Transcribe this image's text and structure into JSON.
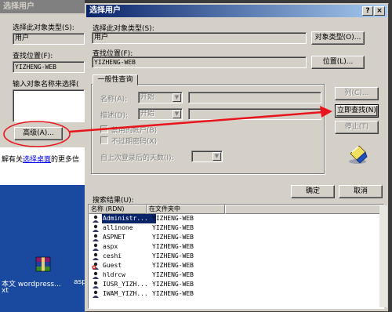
{
  "bg_dialog": {
    "title": "选择用户",
    "object_type_label": "选择此对象类型(S):",
    "object_type_value": "用户",
    "location_label": "查找位置(F):",
    "location_value": "YIZHENG-WEB",
    "enter_names_label": "输入对象名称来选择(",
    "advanced_button": "高级(A)...",
    "help_text_prefix": "解有关",
    "help_link": "选择桌面",
    "help_text_suffix": "的更多信"
  },
  "desktop": {
    "icon_label": "本文 wordpress...",
    "icon_label_2": "asp",
    "icon_label_3": "xt"
  },
  "dialog": {
    "title": "选择用户",
    "help_button": "?",
    "close_button": "×",
    "object_type_label": "选择此对象类型(S):",
    "object_type_value": "用户",
    "object_type_button": "对象类型(O)...",
    "location_label": "查找位置(F):",
    "location_value": "YIZHENG-WEB",
    "location_button": "位置(L)...",
    "tab_general": "一般性查询",
    "name_label": "名称(A):",
    "name_op": "开始",
    "desc_label": "描述(D):",
    "desc_op": "开始",
    "disabled_accounts": "禁用的帐户(B)",
    "no_expire_pwd": "不过期密码(X)",
    "days_since_logon": "自上次登录后的天数(I):",
    "columns_button": "列(C)...",
    "find_now_button": "立即查找(N)",
    "stop_button": "停止(T)",
    "search_results_label": "搜索结果(U):",
    "ok_button": "确定",
    "cancel_button": "取消"
  },
  "results": {
    "columns": [
      "名称 (RDN)",
      "在文件夹中"
    ],
    "rows": [
      {
        "name": "Administr...",
        "folder": "YIZHENG-WEB",
        "selected": true
      },
      {
        "name": "allinone",
        "folder": "YIZHENG-WEB"
      },
      {
        "name": "ASPNET",
        "folder": "YIZHENG-WEB"
      },
      {
        "name": "aspx",
        "folder": "YIZHENG-WEB"
      },
      {
        "name": "ceshi",
        "folder": "YIZHENG-WEB"
      },
      {
        "name": "Guest",
        "folder": "YIZHENG-WEB",
        "disabled": true
      },
      {
        "name": "hldrcw",
        "folder": "YIZHENG-WEB"
      },
      {
        "name": "IUSR_YIZH...",
        "folder": "YIZHENG-WEB"
      },
      {
        "name": "IWAM_YIZH...",
        "folder": "YIZHENG-WEB"
      }
    ]
  },
  "colors": {
    "title_active": "#0a246a",
    "title_inactive": "#808080",
    "annotation_red": "#e8141c",
    "face": "#d4d0c8"
  },
  "icons": [
    "user-icon",
    "disabled-user-icon",
    "search-flashlight-icon",
    "winrar-archive-icon"
  ]
}
